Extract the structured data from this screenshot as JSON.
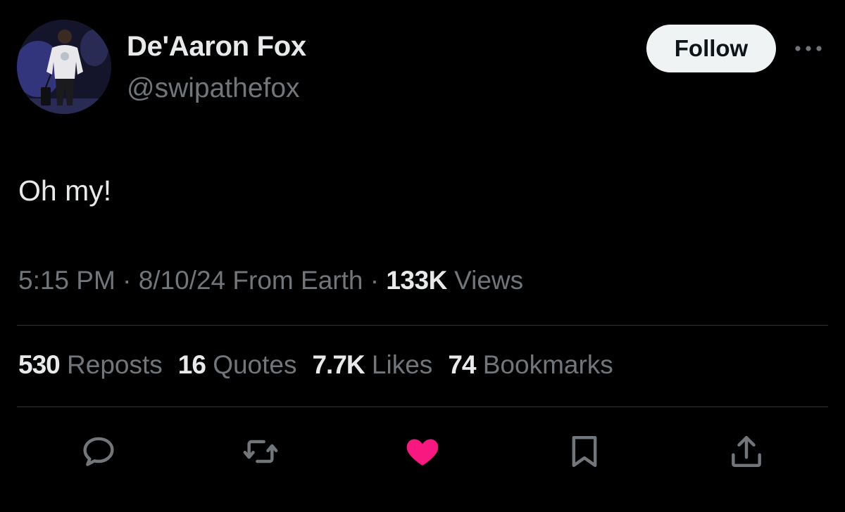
{
  "user": {
    "display_name": "De'Aaron Fox",
    "handle": "@swipathefox",
    "avatar_icon": "profile-photo"
  },
  "follow_label": "Follow",
  "tweet": {
    "text": "Oh my!"
  },
  "meta": {
    "time": "5:15 PM",
    "date": "8/10/24",
    "source": "From Earth",
    "views_count": "133K",
    "views_label": "Views",
    "separator": "·"
  },
  "stats": {
    "reposts_count": "530",
    "reposts_label": "Reposts",
    "quotes_count": "16",
    "quotes_label": "Quotes",
    "likes_count": "7.7K",
    "likes_label": "Likes",
    "bookmarks_count": "74",
    "bookmarks_label": "Bookmarks"
  },
  "actions": [
    "reply-icon",
    "repost-icon",
    "like-icon",
    "bookmark-icon",
    "share-icon"
  ],
  "colors": {
    "background": "#000000",
    "primary_text": "#e7e9ea",
    "secondary_text": "#71767b",
    "divider": "#2f3336",
    "like": "#f91880",
    "follow_bg": "#eff3f4"
  }
}
